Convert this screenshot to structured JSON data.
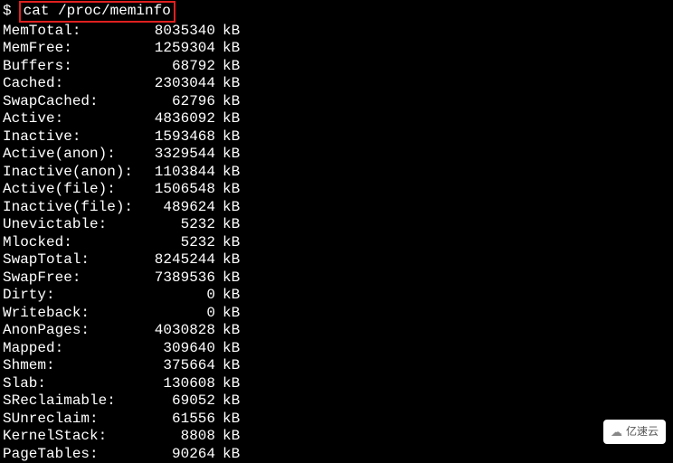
{
  "prompt": "$",
  "command": "cat /proc/meminfo",
  "unit": "kB",
  "lines": [
    {
      "label": "MemTotal:",
      "value": "8035340"
    },
    {
      "label": "MemFree:",
      "value": "1259304"
    },
    {
      "label": "Buffers:",
      "value": "68792"
    },
    {
      "label": "Cached:",
      "value": "2303044"
    },
    {
      "label": "SwapCached:",
      "value": "62796"
    },
    {
      "label": "Active:",
      "value": "4836092"
    },
    {
      "label": "Inactive:",
      "value": "1593468"
    },
    {
      "label": "Active(anon):",
      "value": "3329544"
    },
    {
      "label": "Inactive(anon):",
      "value": "1103844"
    },
    {
      "label": "Active(file):",
      "value": "1506548"
    },
    {
      "label": "Inactive(file):",
      "value": "489624"
    },
    {
      "label": "Unevictable:",
      "value": "5232"
    },
    {
      "label": "Mlocked:",
      "value": "5232"
    },
    {
      "label": "SwapTotal:",
      "value": "8245244"
    },
    {
      "label": "SwapFree:",
      "value": "7389536"
    },
    {
      "label": "Dirty:",
      "value": "0"
    },
    {
      "label": "Writeback:",
      "value": "0"
    },
    {
      "label": "AnonPages:",
      "value": "4030828"
    },
    {
      "label": "Mapped:",
      "value": "309640"
    },
    {
      "label": "Shmem:",
      "value": "375664"
    },
    {
      "label": "Slab:",
      "value": "130608"
    },
    {
      "label": "SReclaimable:",
      "value": "69052"
    },
    {
      "label": "SUnreclaim:",
      "value": "61556"
    },
    {
      "label": "KernelStack:",
      "value": "8808"
    },
    {
      "label": "PageTables:",
      "value": "90264"
    }
  ],
  "watermark": "亿速云"
}
